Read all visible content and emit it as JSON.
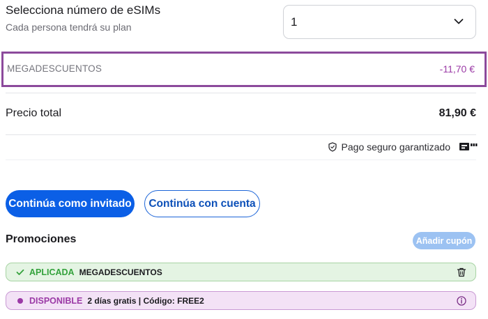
{
  "esims": {
    "title": "Selecciona número de eSIMs",
    "subtitle": "Cada persona tendrá su plan",
    "selected_value": "1"
  },
  "discount": {
    "label": "MEGADESCUENTOS",
    "amount": "-11,70 €"
  },
  "total": {
    "label": "Precio total",
    "amount": "81,90 €"
  },
  "secure": {
    "text": "Pago seguro garantizado"
  },
  "actions": {
    "guest_label": "Continúa como invitado",
    "account_label": "Continúa con cuenta"
  },
  "promotions": {
    "title": "Promociones",
    "add_coupon_label": "Añadir cupón",
    "items": [
      {
        "status": "APLICADA",
        "description": "MEGADESCUENTOS"
      },
      {
        "status": "DISPONIBLE",
        "description": "2 días gratis | Código: FREE2"
      }
    ]
  },
  "colors": {
    "primary": "#0b5fe6",
    "discount_accent": "#9b3aa6",
    "applied_green": "#34a23c",
    "applied_bg": "#e4f4e3",
    "available_bg": "#f3e2f6"
  },
  "icons": {
    "quantity_dropdown": "chevron-down-icon",
    "secure_payment": "shield-icon",
    "payment_badge": "payment-badge-icon",
    "applied": "check-icon",
    "remove": "trash-icon",
    "available": "dot-icon",
    "info": "info-icon"
  }
}
